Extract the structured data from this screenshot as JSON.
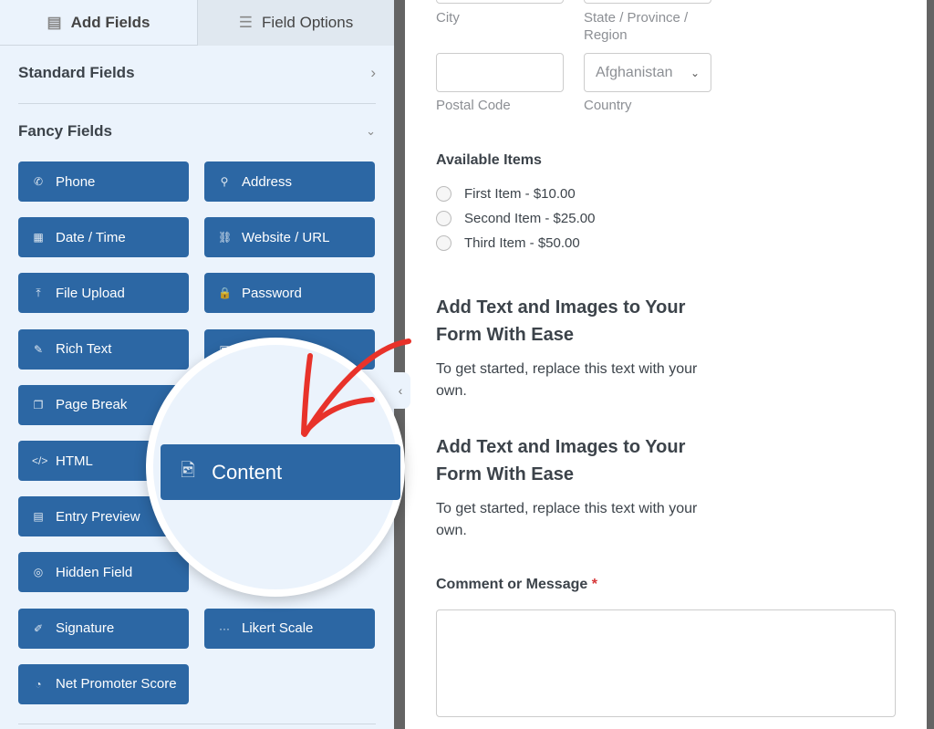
{
  "tabs": {
    "add_fields": "Add Fields",
    "field_options": "Field Options"
  },
  "sections": {
    "standard": "Standard Fields",
    "fancy": "Fancy Fields"
  },
  "fancy_fields": [
    {
      "label": "Phone",
      "icon": "phone-icon",
      "glyph": "✆"
    },
    {
      "label": "Address",
      "icon": "map-pin-icon",
      "glyph": "⚲"
    },
    {
      "label": "Date / Time",
      "icon": "calendar-icon",
      "glyph": "▦"
    },
    {
      "label": "Website / URL",
      "icon": "link-icon",
      "glyph": "⛓"
    },
    {
      "label": "File Upload",
      "icon": "upload-icon",
      "glyph": "⤒"
    },
    {
      "label": "Password",
      "icon": "lock-icon",
      "glyph": "🔒"
    },
    {
      "label": "Rich Text",
      "icon": "edit-icon",
      "glyph": "✎"
    },
    {
      "label": "",
      "icon": "image-icon",
      "glyph": "▣"
    },
    {
      "label": "Page Break",
      "icon": "copy-icon",
      "glyph": "❐"
    },
    {
      "label": "",
      "icon": "",
      "glyph": ""
    },
    {
      "label": "HTML",
      "icon": "code-icon",
      "glyph": "</>"
    },
    {
      "label": "",
      "icon": "",
      "glyph": ""
    },
    {
      "label": "Entry Preview",
      "icon": "file-icon",
      "glyph": "▤"
    },
    {
      "label": "",
      "icon": "",
      "glyph": ""
    },
    {
      "label": "Hidden Field",
      "icon": "eye-slash-icon",
      "glyph": "◎"
    },
    {
      "label": "",
      "icon": "",
      "glyph": ""
    },
    {
      "label": "Signature",
      "icon": "pen-icon",
      "glyph": "✐"
    },
    {
      "label": "Likert Scale",
      "icon": "dots-icon",
      "glyph": "···"
    },
    {
      "label": "Net Promoter Score",
      "icon": "gauge-icon",
      "glyph": "◔"
    }
  ],
  "magnified": {
    "label": "Content",
    "icon": "image-file-icon"
  },
  "annotation_color": "#e8322a",
  "form": {
    "city": "City",
    "state": "State / Province / Region",
    "postal": "Postal Code",
    "country_label": "Country",
    "country_value": "Afghanistan",
    "available_items": "Available Items",
    "items": [
      "First Item - $10.00",
      "Second Item - $25.00",
      "Third Item - $50.00"
    ],
    "content_blocks": [
      {
        "title": "Add Text and Images to Your Form With Ease",
        "text": "To get started, replace this text with your own."
      },
      {
        "title": "Add Text and Images to Your Form With Ease",
        "text": "To get started, replace this text with your own."
      }
    ],
    "comment_label": "Comment or Message",
    "required_mark": "*"
  }
}
